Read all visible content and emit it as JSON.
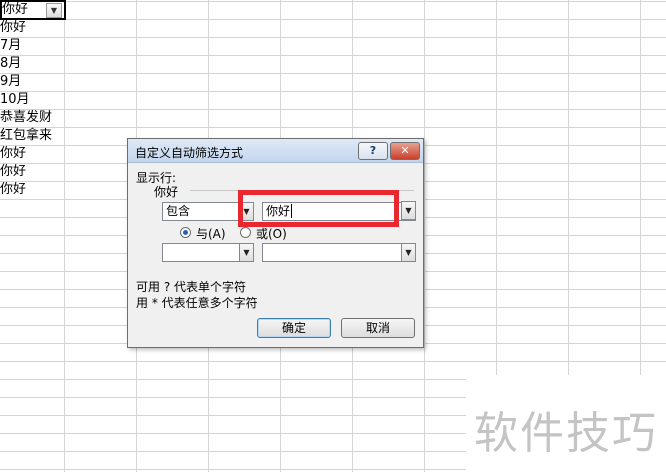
{
  "sheet": {
    "header_cell": "你好",
    "rows": [
      "你好",
      "7月",
      "8月",
      "9月",
      "10月",
      "恭喜发财",
      "红包拿来",
      "你好",
      "你好",
      "你好"
    ]
  },
  "dialog": {
    "title": "自定义自动筛选方式",
    "show_rows_label": "显示行:",
    "field_name": "你好",
    "condition1": {
      "operator": "包含",
      "value": "你好"
    },
    "logic": {
      "and_label": "与(A)",
      "or_label": "或(O)",
      "selected": "and"
    },
    "condition2": {
      "operator": "",
      "value": ""
    },
    "hint1": "可用 ? 代表单个字符",
    "hint2": "用 * 代表任意多个字符",
    "ok_label": "确定",
    "cancel_label": "取消",
    "help_glyph": "?",
    "close_glyph": "✕"
  },
  "watermark": "软件技巧",
  "colors": {
    "highlight": "#e8282e",
    "radio_dot": "#2a61b8"
  }
}
